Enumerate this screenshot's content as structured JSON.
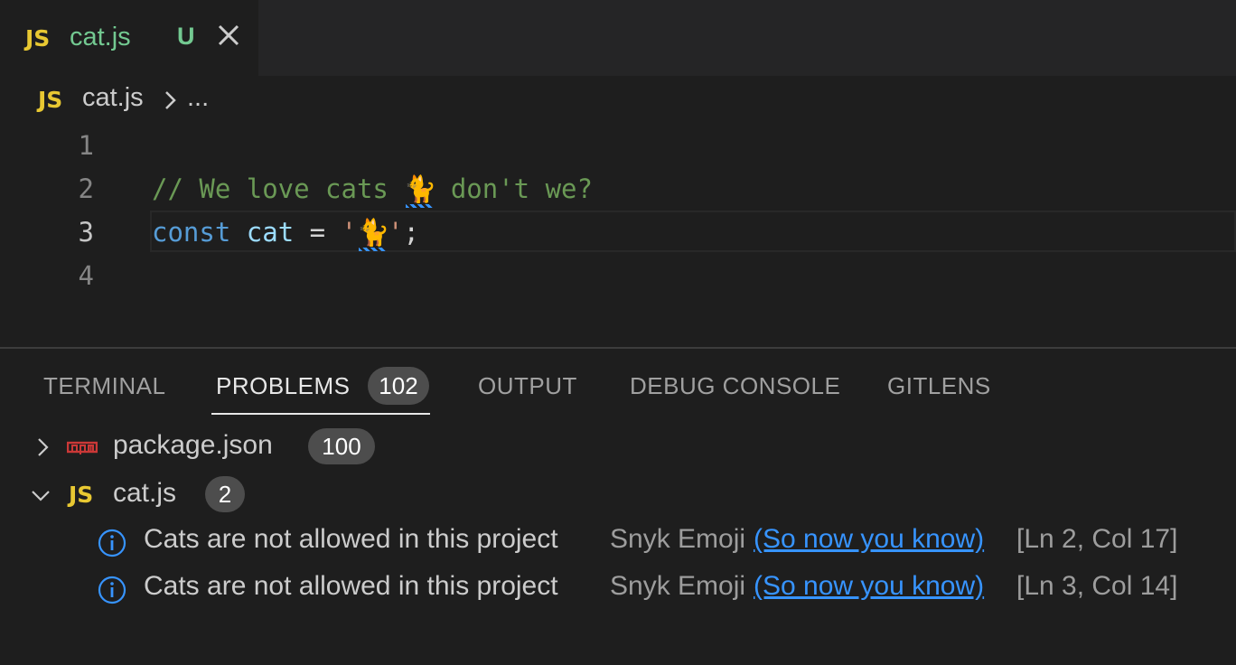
{
  "tab": {
    "lang_icon": "JS",
    "name": "cat.js",
    "status": "U",
    "close_icon": "close-icon"
  },
  "breadcrumb": {
    "lang_icon": "JS",
    "file": "cat.js",
    "more": "..."
  },
  "editor": {
    "lines": [
      {
        "number": "1"
      },
      {
        "number": "2",
        "comment_a": "// We love cats ",
        "emoji": "🐈",
        "comment_b": " don't we?"
      },
      {
        "number": "3",
        "keyword": "const",
        "name": "cat",
        "op": "=",
        "str_open": "'",
        "emoji": "🐈",
        "str_close": "'",
        "semi": ";"
      },
      {
        "number": "4"
      }
    ],
    "active_line": 3
  },
  "panel": {
    "tabs": [
      {
        "label": "TERMINAL"
      },
      {
        "label": "PROBLEMS",
        "badge": "102",
        "active": true
      },
      {
        "label": "OUTPUT"
      },
      {
        "label": "DEBUG CONSOLE"
      },
      {
        "label": "GITLENS"
      }
    ],
    "groups": [
      {
        "icon": "npm-icon",
        "name": "package.json",
        "count": "100",
        "expanded": false
      },
      {
        "icon": "JS",
        "name": "cat.js",
        "count": "2",
        "expanded": true,
        "problems": [
          {
            "icon": "info-icon",
            "message": "Cats are not allowed in this project",
            "source": "Snyk Emoji",
            "link": "(So now you know)",
            "location": "[Ln 2, Col 17]"
          },
          {
            "icon": "info-icon",
            "message": "Cats are not allowed in this project",
            "source": "Snyk Emoji",
            "link": "(So now you know)",
            "location": "[Ln 3, Col 14]"
          }
        ]
      }
    ]
  },
  "colors": {
    "accent": "#3794ff",
    "js": "#e8c832",
    "modified": "#73c991",
    "comment": "#6a9955",
    "keyword": "#569cd6",
    "npm": "#cb3837"
  }
}
